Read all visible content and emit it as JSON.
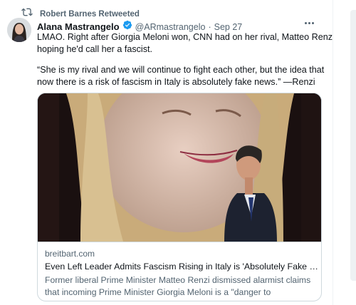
{
  "retweet": {
    "label": "Robert Barnes Retweeted",
    "icon": "retweet-icon"
  },
  "tweet": {
    "display_name": "Alana Mastrangelo",
    "handle": "@ARmastrangelo",
    "separator": "·",
    "timestamp": "Sep 27",
    "verified_icon": "verified-badge-icon",
    "more_icon": "more-icon",
    "lines": [
      "LMAO. Right after Giorgia Meloni won, CNN had on her rival, Matteo Renzi,",
      "hoping he'd call her a fascist.",
      "“She is my rival and we will continue to fight each other, but the idea that",
      "now there is a risk of fascism in Italy is absolutely fake news.” —Renzi"
    ]
  },
  "card": {
    "domain": "breitbart.com",
    "title": "Even Left Leader Admits Fascism Rising in Italy is 'Absolutely Fake Ne...",
    "description_lines": [
      "Former liberal Prime Minister Matteo Renzi dismissed alarmist claims",
      "that incoming Prime Minister Giorgia Meloni is a \"danger to democracy\"."
    ]
  },
  "colors": {
    "text_primary": "#0f1419",
    "text_secondary": "#536471",
    "verified_blue": "#1d9bf0",
    "border": "#cfd9de"
  }
}
